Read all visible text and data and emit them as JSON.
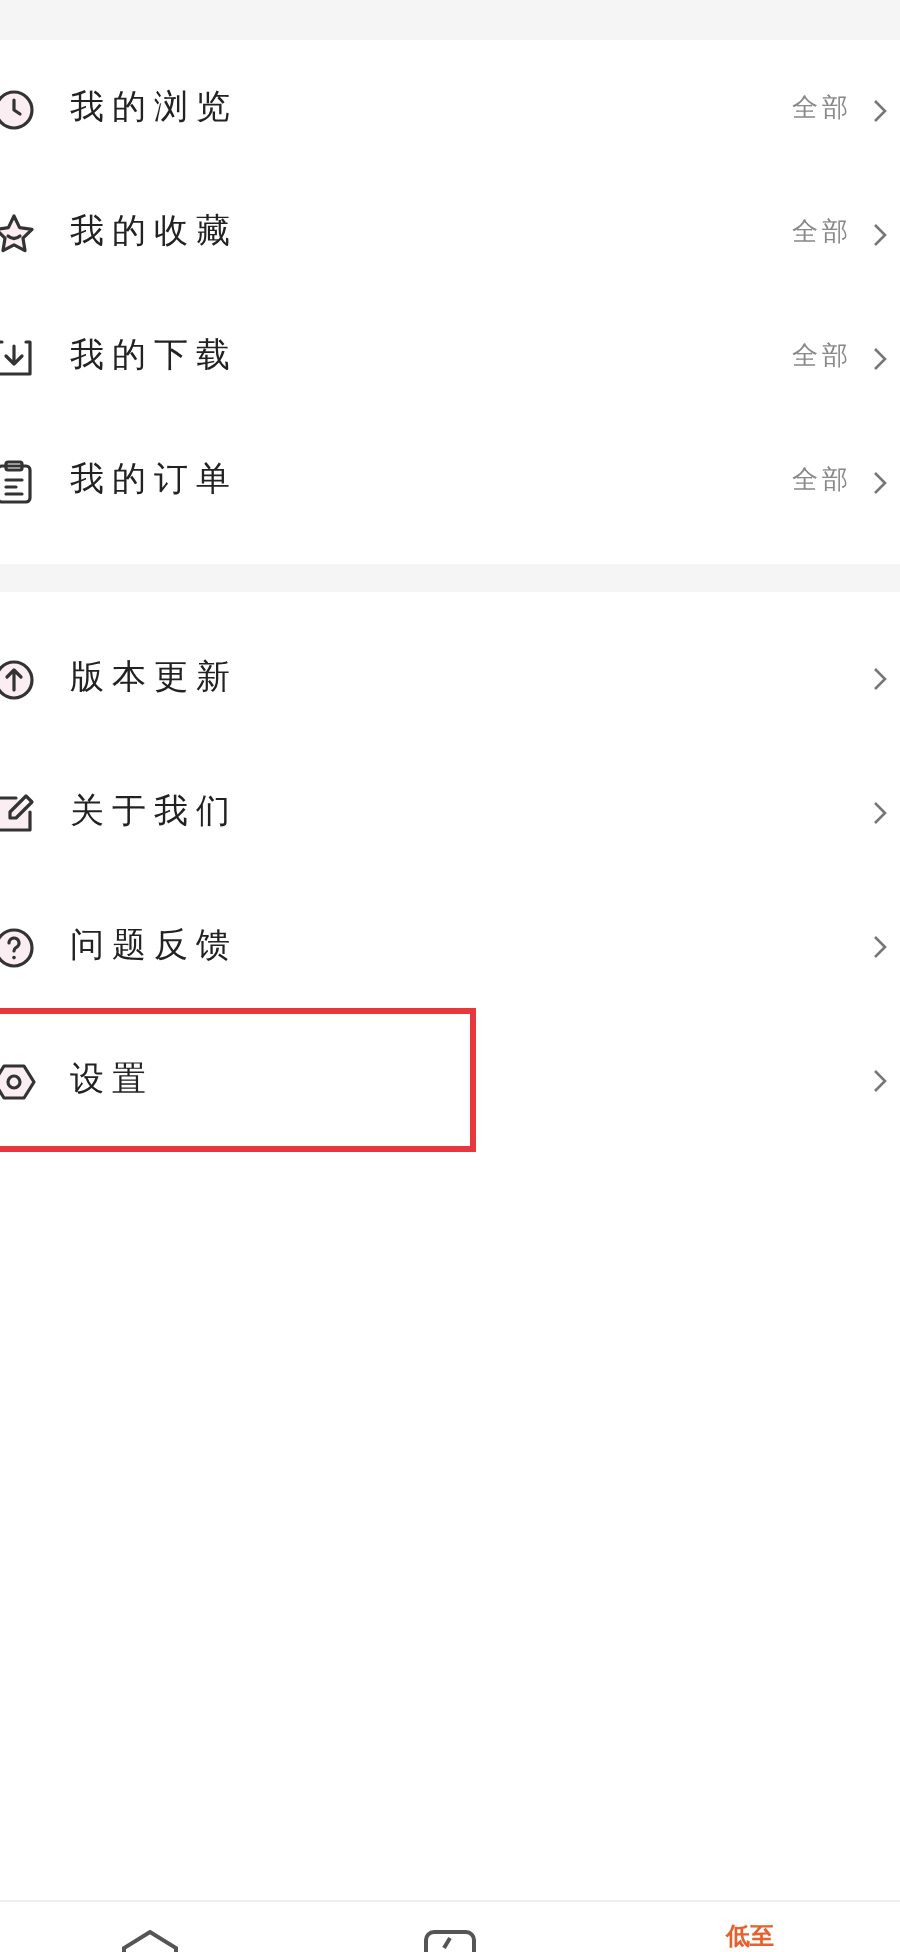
{
  "history_section": [
    {
      "kind": "clock",
      "label": "我的浏览",
      "action": "全部"
    },
    {
      "kind": "star",
      "label": "我的收藏",
      "action": "全部"
    },
    {
      "kind": "download",
      "label": "我的下载",
      "action": "全部"
    },
    {
      "kind": "clipboard",
      "label": "我的订单",
      "action": "全部"
    }
  ],
  "app_section": [
    {
      "kind": "upload",
      "label": "版本更新",
      "highlighted": false
    },
    {
      "kind": "edit",
      "label": "关于我们",
      "highlighted": false
    },
    {
      "kind": "help",
      "label": "问题反馈",
      "highlighted": false
    },
    {
      "kind": "settings",
      "label": "设置",
      "highlighted": true
    }
  ],
  "tab_bar": [
    {
      "kind": "home",
      "selected": false
    },
    {
      "kind": "task",
      "selected": false
    },
    {
      "kind": "text",
      "label": "低至",
      "selected": true
    }
  ]
}
